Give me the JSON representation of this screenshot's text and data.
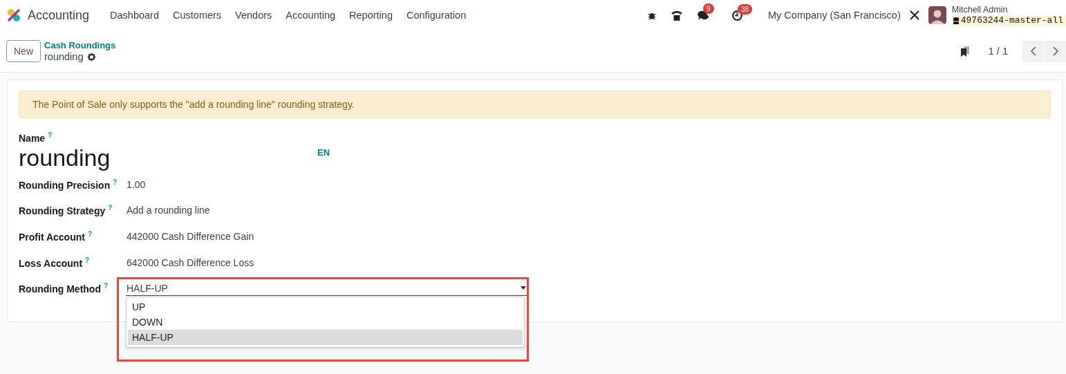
{
  "navbar": {
    "app_name": "Accounting",
    "menu": [
      "Dashboard",
      "Customers",
      "Vendors",
      "Accounting",
      "Reporting",
      "Configuration"
    ],
    "messages_count": "9",
    "activities_count": "38",
    "company": "My Company (San Francisco)",
    "user_name": "Mitchell Admin",
    "database": "49763244-master-all"
  },
  "control_panel": {
    "new_button": "New",
    "breadcrumb": "Cash Roundings",
    "record_name": "rounding",
    "pager": "1 / 1"
  },
  "alert": "The Point of Sale only supports the \"add a rounding line\" rounding strategy.",
  "form": {
    "name_label": "Name",
    "name_help": "?",
    "name_value": "rounding",
    "language": "EN",
    "fields": [
      {
        "label": "Rounding Precision",
        "help": "?",
        "value": "1.00"
      },
      {
        "label": "Rounding Strategy",
        "help": "?",
        "value": "Add a rounding line"
      },
      {
        "label": "Profit Account",
        "help": "?",
        "value": "442000 Cash Difference Gain"
      },
      {
        "label": "Loss Account",
        "help": "?",
        "value": "642000 Cash Difference Loss"
      }
    ],
    "rounding_method": {
      "label": "Rounding Method",
      "help": "?",
      "value": "HALF-UP",
      "expanded": true,
      "highlighted": true,
      "options": [
        {
          "label": "UP",
          "selected": false
        },
        {
          "label": "DOWN",
          "selected": false
        },
        {
          "label": "HALF-UP",
          "selected": true
        }
      ]
    }
  }
}
